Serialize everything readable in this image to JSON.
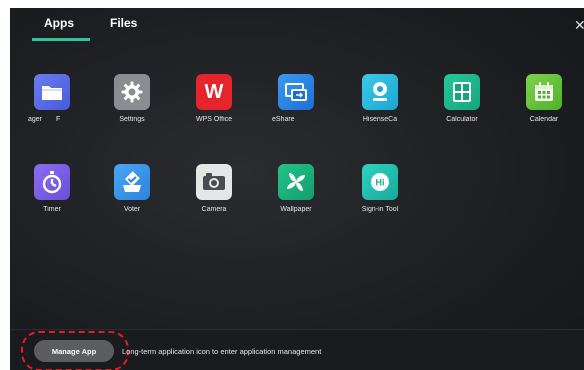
{
  "tabs": {
    "apps": "Apps",
    "files": "Files"
  },
  "colors": {
    "accent": "#2ec59a",
    "highlight": "#e21d24"
  },
  "apps_row1": [
    {
      "label": "ager",
      "label2": "F",
      "icon": "folder-icon"
    },
    {
      "label": "Settings",
      "icon": "gear-icon"
    },
    {
      "label": "WPS Office",
      "icon": "wps-icon"
    },
    {
      "label": "eShare",
      "icon": "screen-share-icon"
    },
    {
      "label": "HisenseCa",
      "icon": "webcam-icon"
    },
    {
      "label": "Calculator",
      "icon": "calculator-icon"
    },
    {
      "label": "Calendar",
      "icon": "calendar-icon"
    }
  ],
  "apps_row2": [
    {
      "label": "Timer",
      "icon": "timer-icon"
    },
    {
      "label": "Voter",
      "icon": "vote-icon"
    },
    {
      "label": "Camera",
      "icon": "camera-icon"
    },
    {
      "label": "Wallpaper",
      "icon": "pinwheel-icon"
    },
    {
      "label": "Sign-in Tool",
      "icon": "sign-in-icon"
    }
  ],
  "footer": {
    "manage_button": "Manage App",
    "hint": "Long-term application icon to enter application management"
  }
}
